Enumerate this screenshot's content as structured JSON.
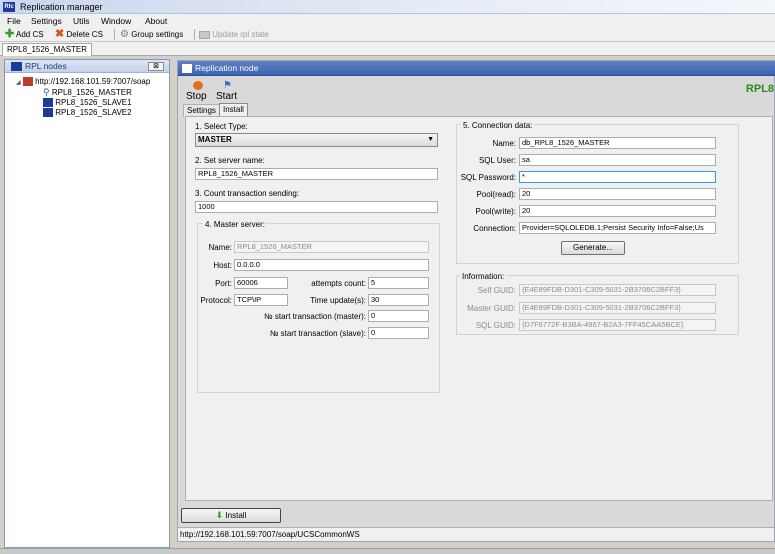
{
  "window": {
    "title": "Replication manager",
    "icon_text": "Rlc"
  },
  "menu": [
    "File",
    "Settings",
    "Utils",
    "Window",
    "About"
  ],
  "toolbar": {
    "add_cs": "Add CS",
    "delete_cs": "Delete CS",
    "group_settings": "Group settings",
    "update_rpl_state": "Update rpl state"
  },
  "doc_tab": "RPL8_1526_MASTER",
  "left_panel": {
    "title": "RPL nodes",
    "close": "⊠",
    "tree": {
      "root": "http://192.168.101.59:7007/soap",
      "children": [
        "RPL8_1526_MASTER",
        "RPL8_1526_SLAVE1",
        "RPL8_1526_SLAVE2"
      ]
    }
  },
  "right_panel": {
    "title": "Replication node",
    "node_tag": "RPL8",
    "stop_label": "Stop",
    "start_label": "Start",
    "tabs": [
      "Settings",
      "Install"
    ],
    "active_tab": "Install"
  },
  "form": {
    "select_type": {
      "label": "1. Select Type:",
      "value": "MASTER"
    },
    "server_name": {
      "label": "2. Set server name:",
      "value": "RPL8_1526_MASTER"
    },
    "count": {
      "label": "3. Count  transaction sending:",
      "value": "1000"
    },
    "master_server": {
      "legend": "4. Master server:",
      "name_label": "Name:",
      "name_value": "RPL8_1526_MASTER",
      "host_label": "Host:",
      "host_value": "0.0.0.0",
      "port_label": "Port:",
      "port_value": "60006",
      "attempts_label": "attempts count:",
      "attempts_value": "5",
      "protocol_label": "Protocol:",
      "protocol_value": "TCP\\IP",
      "time_label": "Time update(s):",
      "time_value": "30",
      "start_master_label": "№ start transaction (master):",
      "start_master_value": "0",
      "start_slave_label": "№ start transaction (slave):",
      "start_slave_value": "0"
    },
    "connection": {
      "legend": "5. Connection data:",
      "name_label": "Name:",
      "name_value": "db_RPL8_1526_MASTER",
      "user_label": "SQL User:",
      "user_value": "sa",
      "password_label": "SQL Password:",
      "password_value": "*",
      "pool_read_label": "Pool(read):",
      "pool_read_value": "20",
      "pool_write_label": "Pool(write):",
      "pool_write_value": "20",
      "connection_label": "Connection:",
      "connection_value": "Provider=SQLOLEDB.1;Persist Security Info=False;Us",
      "generate_label": "Generate..."
    },
    "information": {
      "legend": "Information:",
      "self_guid_label": "Self GUID:",
      "self_guid_value": "{E4E89FDB-D301-C309-5031-2B3706C2BFF3}",
      "master_guid_label": "Master GUID:",
      "master_guid_value": "{E4E89FDB-D301-C309-5031-2B3706C2BFF3}",
      "sql_guid_label": "SQL GUID:",
      "sql_guid_value": "{D7F6772F-B3BA-4967-B2A3-7FF45CAA5BCE}"
    }
  },
  "install_button": "Install",
  "status_url": "http://192.168.101.59:7007/soap/UCSCommonWS",
  "colors": {
    "accent_header": "#3b62b0",
    "node_tag": "#2e8b1e",
    "focus_border": "#3399ff"
  }
}
